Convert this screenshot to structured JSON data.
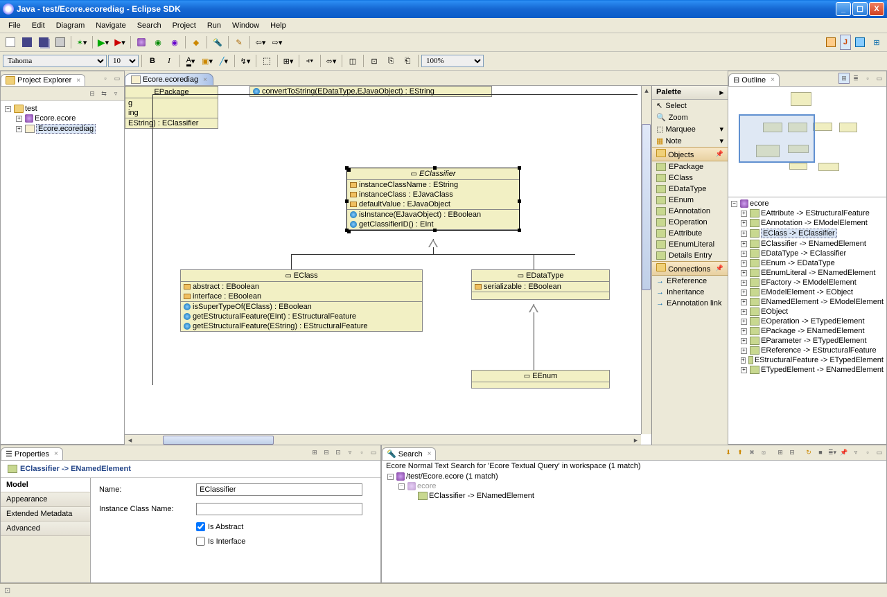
{
  "title": "Java - test/Ecore.ecorediag - Eclipse SDK",
  "menu": [
    "File",
    "Edit",
    "Diagram",
    "Navigate",
    "Search",
    "Project",
    "Run",
    "Window",
    "Help"
  ],
  "font_combo": "Tahoma",
  "size_combo": "10",
  "zoom": "100%",
  "project_explorer": {
    "title": "Project Explorer",
    "root": "test",
    "files": [
      "Ecore.ecore",
      "Ecore.ecorediag"
    ]
  },
  "editor_tab": "Ecore.ecorediag",
  "diagram": {
    "top_op": "convertToString(EDataType,EJavaObject) : EString",
    "epackage": {
      "name": "EPackage",
      "attrs": [
        "g",
        "ing"
      ],
      "ops": [
        "EString) : EClassifier"
      ]
    },
    "eclassifier": {
      "name": "EClassifier",
      "attrs": [
        "instanceClassName : EString",
        "instanceClass : EJavaClass",
        "defaultValue : EJavaObject"
      ],
      "ops": [
        "isInstance(EJavaObject) : EBoolean",
        "getClassifierID() : EInt"
      ]
    },
    "eclass": {
      "name": "EClass",
      "attrs": [
        "abstract : EBoolean",
        "interface : EBoolean"
      ],
      "ops": [
        "isSuperTypeOf(EClass) : EBoolean",
        "getEStructuralFeature(EInt) : EStructuralFeature",
        "getEStructuralFeature(EString) : EStructuralFeature"
      ]
    },
    "edatatype": {
      "name": "EDataType",
      "attrs": [
        "serializable : EBoolean"
      ]
    },
    "eenum": {
      "name": "EEnum"
    }
  },
  "palette": {
    "title": "Palette",
    "tools": [
      "Select",
      "Zoom",
      "Marquee",
      "Note"
    ],
    "objects_cat": "Objects",
    "objects": [
      "EPackage",
      "EClass",
      "EDataType",
      "EEnum",
      "EAnnotation",
      "EOperation",
      "EAttribute",
      "EEnumLiteral",
      "Details Entry"
    ],
    "conn_cat": "Connections",
    "connections": [
      "EReference",
      "Inheritance",
      "EAnnotation link"
    ]
  },
  "outline": {
    "title": "Outline",
    "root": "ecore",
    "items": [
      "EAttribute -> EStructuralFeature",
      "EAnnotation -> EModelElement",
      "EClass -> EClassifier",
      "EClassifier -> ENamedElement",
      "EDataType -> EClassifier",
      "EEnum -> EDataType",
      "EEnumLiteral -> ENamedElement",
      "EFactory -> EModelElement",
      "EModelElement -> EObject",
      "ENamedElement -> EModelElement",
      "EObject",
      "EOperation -> ETypedElement",
      "EPackage -> ENamedElement",
      "EParameter -> ETypedElement",
      "EReference -> EStructuralFeature",
      "EStructuralFeature -> ETypedElement",
      "ETypedElement -> ENamedElement"
    ]
  },
  "properties": {
    "title": "Properties",
    "header": "EClassifier -> ENamedElement",
    "tabs": [
      "Model",
      "Appearance",
      "Extended Metadata",
      "Advanced"
    ],
    "active_tab": 0,
    "name_label": "Name:",
    "name_value": "EClassifier",
    "icn_label": "Instance Class Name:",
    "icn_value": "",
    "is_abstract_label": "Is Abstract",
    "is_abstract": true,
    "is_interface_label": "Is Interface",
    "is_interface": false
  },
  "search": {
    "title": "Search",
    "summary": "Ecore Normal Text Search for 'Ecore Textual Query' in workspace (1 match)",
    "file": "/test/Ecore.ecore (1 match)",
    "pkg": "ecore",
    "result": "EClassifier -> ENamedElement"
  }
}
